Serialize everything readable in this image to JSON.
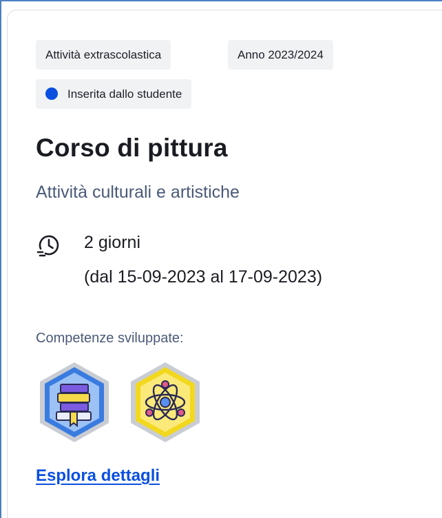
{
  "tags": {
    "activity_type": "Attività extrascolastica",
    "school_year": "Anno 2023/2024",
    "source": "Inserita dallo studente"
  },
  "activity": {
    "title": "Corso di pittura",
    "category": "Attività culturali e artistiche",
    "duration": "2 giorni",
    "dates": "(dal 15-09-2023 al 17-09-2023)"
  },
  "skills": {
    "label": "Competenze sviluppate:",
    "badges": [
      {
        "icon": "books-badge-icon",
        "color": "#3a7be0"
      },
      {
        "icon": "atom-badge-icon",
        "color": "#f2d81e"
      }
    ]
  },
  "actions": {
    "explore_label": "Esplora dettagli"
  },
  "colors": {
    "accent": "#0a4fe0",
    "muted_text": "#4a5a78",
    "tag_bg": "#f1f2f4"
  }
}
